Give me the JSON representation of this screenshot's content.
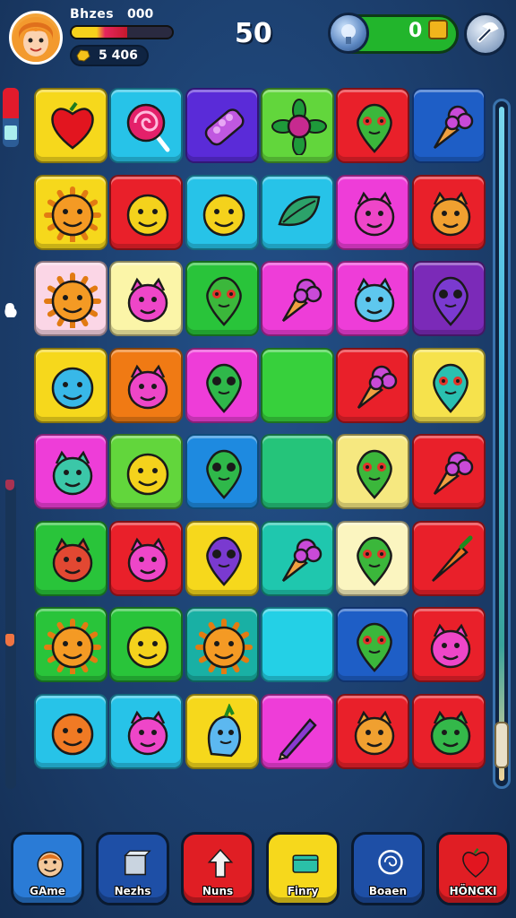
{
  "hud": {
    "player_name": "Bhzes",
    "player_score": "000",
    "health_fraction": 0.55,
    "coins": "5 406",
    "moves": "50",
    "gems": "0"
  },
  "board": {
    "cols": 6,
    "rows": 8,
    "tiles": [
      {
        "color": "#f6d81c",
        "icon": "heart-icon"
      },
      {
        "color": "#27c3e8",
        "icon": "lollipop-icon"
      },
      {
        "color": "#5a2bd8",
        "icon": "grape-candy-icon"
      },
      {
        "color": "#62d63c",
        "icon": "flower-icon"
      },
      {
        "color": "#e9202a",
        "icon": "green-alien-icon"
      },
      {
        "color": "#1e5ec6",
        "icon": "ice-cream-cone-icon"
      },
      {
        "color": "#f6d81c",
        "icon": "sun-face-icon"
      },
      {
        "color": "#e9202a",
        "icon": "yellow-face-icon"
      },
      {
        "color": "#27c3e8",
        "icon": "yellow-face-icon"
      },
      {
        "color": "#27c3e8",
        "icon": "leaf-creature-icon"
      },
      {
        "color": "#ee3dd8",
        "icon": "pink-monster-icon"
      },
      {
        "color": "#e9202a",
        "icon": "orange-monster-icon"
      },
      {
        "color": "#fbd6e6",
        "icon": "sun-face-icon"
      },
      {
        "color": "#fbf5a8",
        "icon": "pink-monster-icon"
      },
      {
        "color": "#29c43a",
        "icon": "green-alien-icon"
      },
      {
        "color": "#ee3dd8",
        "icon": "ice-cream-cone-icon"
      },
      {
        "color": "#ee3dd8",
        "icon": "blue-monster-icon"
      },
      {
        "color": "#7b2ab8",
        "icon": "purple-drop-icon"
      },
      {
        "color": "#f6d81c",
        "icon": "blue-face-icon"
      },
      {
        "color": "#f07a14",
        "icon": "pink-monster-icon"
      },
      {
        "color": "#ee3dd8",
        "icon": "green-drop-icon"
      },
      {
        "color": "#37d03c",
        "icon": ""
      },
      {
        "color": "#e9202a",
        "icon": "ice-cream-cone-icon"
      },
      {
        "color": "#f6e24c",
        "icon": "teal-drop-icon"
      },
      {
        "color": "#ee3dd8",
        "icon": "teal-monster-icon"
      },
      {
        "color": "#62d63c",
        "icon": "yellow-face-icon"
      },
      {
        "color": "#1e8ae0",
        "icon": "green-drop-icon"
      },
      {
        "color": "#25c47a",
        "icon": ""
      },
      {
        "color": "#f6e880",
        "icon": "green-alien-icon"
      },
      {
        "color": "#e9202a",
        "icon": "ice-cream-cone-icon"
      },
      {
        "color": "#29c43a",
        "icon": "red-monster-icon"
      },
      {
        "color": "#e9202a",
        "icon": "pink-monster-icon"
      },
      {
        "color": "#f6d81c",
        "icon": "purple-drop-icon"
      },
      {
        "color": "#1fc7ae",
        "icon": "ice-cream-cone-icon"
      },
      {
        "color": "#fbf5c0",
        "icon": "green-alien-icon"
      },
      {
        "color": "#e9202a",
        "icon": "carrot-icon"
      },
      {
        "color": "#29c43a",
        "icon": "sun-face-icon"
      },
      {
        "color": "#29c43a",
        "icon": "yellow-face-icon"
      },
      {
        "color": "#19b0a4",
        "icon": "sun-face-icon"
      },
      {
        "color": "#24d0e6",
        "icon": ""
      },
      {
        "color": "#1e5ec6",
        "icon": "green-alien-icon"
      },
      {
        "color": "#e9202a",
        "icon": "pink-monster-icon"
      },
      {
        "color": "#27c3e8",
        "icon": "orange-face-icon"
      },
      {
        "color": "#27c3e8",
        "icon": "pink-monster-icon"
      },
      {
        "color": "#f6d81c",
        "icon": "blue-creature-icon"
      },
      {
        "color": "#ee3dd8",
        "icon": "purple-pencil-icon"
      },
      {
        "color": "#e9202a",
        "icon": "orange-monster-icon"
      },
      {
        "color": "#e9202a",
        "icon": "green-monster-icon"
      }
    ]
  },
  "nav": {
    "items": [
      {
        "label": "GAme",
        "color": "#2a7bd6",
        "icon": "character-icon"
      },
      {
        "label": "Nezhs",
        "color": "#1e4fa6",
        "icon": "box-icon"
      },
      {
        "label": "Nuns",
        "color": "#e01e24",
        "icon": "arrow-icon"
      },
      {
        "label": "Finry",
        "color": "#f6d81c",
        "icon": "card-icon"
      },
      {
        "label": "Boaen",
        "color": "#1e4fa6",
        "icon": "swirl-icon"
      },
      {
        "label": "HÖNCKI",
        "color": "#e01e24",
        "icon": "heart-icon"
      }
    ]
  }
}
